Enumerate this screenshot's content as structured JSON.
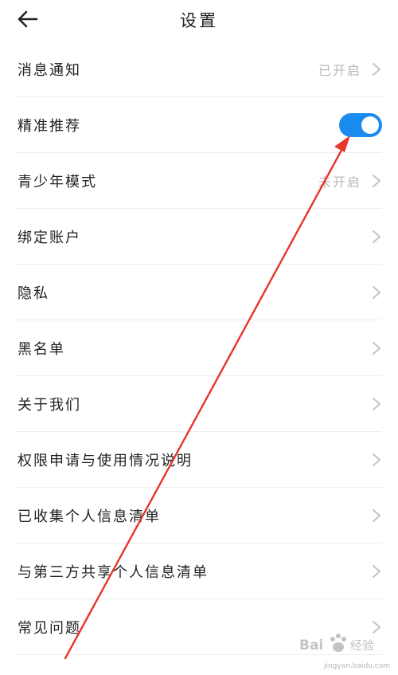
{
  "header": {
    "title": "设置"
  },
  "settings": {
    "items": [
      {
        "label": "消息通知",
        "status": "已开启"
      },
      {
        "label": "精准推荐",
        "toggle": true
      },
      {
        "label": "青少年模式",
        "status": "未开启"
      },
      {
        "label": "绑定账户"
      },
      {
        "label": "隐私"
      },
      {
        "label": "黑名单"
      },
      {
        "label": "关于我们"
      },
      {
        "label": "权限申请与使用情况说明"
      },
      {
        "label": "已收集个人信息清单"
      },
      {
        "label": "与第三方共享个人信息清单"
      },
      {
        "label": "常见问题"
      }
    ]
  },
  "colors": {
    "accent": "#1a8cf0",
    "annotation_arrow": "#e8342a"
  },
  "icons": {
    "back": "arrow-left-icon",
    "chevron": "chevron-right-icon"
  },
  "watermark": {
    "brand": "Bai 经验",
    "url": "jingyan.baidu.com"
  }
}
